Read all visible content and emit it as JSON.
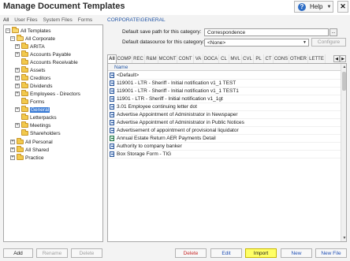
{
  "window": {
    "title": "Manage Document Templates",
    "help_label": "Help",
    "close_glyph": "✕"
  },
  "file_tabs": [
    "All",
    "User Files",
    "System Files",
    "Forms"
  ],
  "tree": [
    {
      "label": "All Templates",
      "expander": "−"
    },
    {
      "label": "All Corporate",
      "expander": "−"
    },
    {
      "label": "ARITA",
      "expander": "+"
    },
    {
      "label": "Accounts Payable",
      "expander": "+"
    },
    {
      "label": "Accounts Receivable",
      "expander": ""
    },
    {
      "label": "Assets",
      "expander": "+"
    },
    {
      "label": "Creditors",
      "expander": "+"
    },
    {
      "label": "Dividends",
      "expander": "+"
    },
    {
      "label": "Employees - Directors",
      "expander": "+"
    },
    {
      "label": "Forms",
      "expander": ""
    },
    {
      "label": "General",
      "expander": "+"
    },
    {
      "label": "Letterpacks",
      "expander": ""
    },
    {
      "label": "Meetings",
      "expander": "+"
    },
    {
      "label": "Shareholders",
      "expander": ""
    },
    {
      "label": "All Personal",
      "expander": "+"
    },
    {
      "label": "All Shared",
      "expander": "+"
    },
    {
      "label": "Practice",
      "expander": "+"
    }
  ],
  "detail": {
    "category_path": "CORPORATE\\GENERAL",
    "save_path_label": "Default save path for this category:",
    "save_path_value": "Correspondence",
    "browse_label": "...",
    "datasource_label": "Default datasource for this category:",
    "datasource_value": "<None>",
    "configure_label": "Configure"
  },
  "category_tabs": [
    "All",
    "COMP",
    "REC",
    "R&M",
    "MCONT",
    "CONT",
    "VA",
    "DOCA",
    "CL",
    "MVL",
    "CVL",
    "PL",
    "CT",
    "CONS",
    "OTHER",
    "LETTE"
  ],
  "list": {
    "column_name": "Name",
    "rows": [
      {
        "name": "<Default>",
        "icon": "word-doc-icon"
      },
      {
        "name": "119001 - LTR - Sheriff - Initial notification v1_1 TEST",
        "icon": "word-doc-icon"
      },
      {
        "name": "119001 - LTR - Sheriff - Initial notification v1_1 TEST1",
        "icon": "word-doc-icon"
      },
      {
        "name": "11901 - LTR - Sheriff - Initial notification v1_1gt",
        "icon": "word-doc-icon"
      },
      {
        "name": "3.01 Employee continuing letter dot",
        "icon": "word-doc-icon"
      },
      {
        "name": "Advertise Appointment of Administrator in Newspaper",
        "icon": "word-doc-icon"
      },
      {
        "name": "Advertise Appointment of Administrator in Public Notices",
        "icon": "word-doc-icon"
      },
      {
        "name": "Advertisement of appointment of provisional liquidator",
        "icon": "word-doc-icon"
      },
      {
        "name": "Annual Estate Return AER Payments Detail",
        "icon": "excel-doc-icon"
      },
      {
        "name": "Authority to company banker",
        "icon": "word-doc-icon"
      },
      {
        "name": "Box Storage Form - TIG",
        "icon": "word-doc-icon"
      }
    ]
  },
  "buttons": {
    "add": "Add",
    "rename": "Rename",
    "delete_folder": "Delete",
    "delete": "Delete",
    "edit": "Edit",
    "import": "Import",
    "new": "New",
    "new_file": "New File"
  },
  "colors": {
    "selection": "#3a7bd5",
    "link_blue": "#2356a6",
    "delete_red": "#c62828",
    "import_highlight": "#ffff66"
  }
}
